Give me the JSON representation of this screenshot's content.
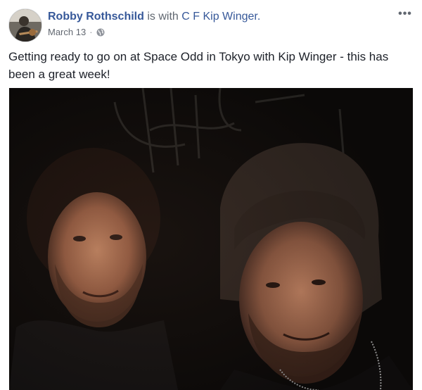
{
  "post": {
    "author": "Robby Rothschild",
    "with_text": "is with",
    "tagged": "C F Kip Winger.",
    "date": "March 13",
    "separator": "·",
    "privacy_icon": "globe-icon",
    "more_icon": "more-options-icon",
    "more_glyph": "•••",
    "text": "Getting ready to go on at Space Odd in Tokyo with Kip Winger - this has been a great week!"
  },
  "colors": {
    "link": "#365899",
    "meta": "#616770",
    "body_text": "#1d2129",
    "photo_bg": "#0b0908"
  }
}
